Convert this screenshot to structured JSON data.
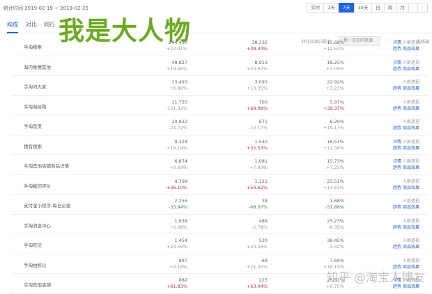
{
  "header": {
    "date_range": "统计时间 2019-02-19 ~ 2019-02-25",
    "periods": [
      "实时",
      "1天",
      "7天",
      "30天",
      "日",
      "周",
      "月"
    ],
    "active_period": "7天",
    "prev": "‹",
    "next": "›"
  },
  "tabs": [
    {
      "label": "构成",
      "active": true
    },
    {
      "label": "对比"
    },
    {
      "label": "同行"
    }
  ],
  "watermark": "我是大人物",
  "attribution": {
    "label": "转化效果归属于：",
    "value": "每一次访问来源",
    "info": "ⓘ",
    "wireless": "无线端"
  },
  "actions": {
    "detail": "详情",
    "crowd": "人群透视",
    "trend": "趋势",
    "goods": "商品效果"
  },
  "rows": [
    {
      "name": "手淘搜索",
      "a": "244,420",
      "ad": "+22.91%",
      "b": "38,332",
      "bd": "+38.44%",
      "bc": "red",
      "c": "15.68%",
      "cd": "+12.63%",
      "detail": true
    },
    {
      "name": "淘内免费其他",
      "a": "48,827",
      "ad": "+19.96%",
      "b": "8,913",
      "bd": "+23.67%",
      "c": "18.25%",
      "cd": "+3.09%",
      "detail": true
    },
    {
      "name": "手淘问大家",
      "a": "13,493",
      "ad": "+6.89%",
      "b": "3,093",
      "bd": "+10.35%",
      "c": "22.92%",
      "cd": "+3.23%"
    },
    {
      "name": "手淘淘抢购",
      "a": "11,735",
      "ad": "+21.32%",
      "b": "700",
      "bd": "+69.08%",
      "bc": "red",
      "c": "5.97%",
      "cd": "+39.37%",
      "cc": "red"
    },
    {
      "name": "手淘首页",
      "a": "10,822",
      "ad": "-24.72%",
      "b": "671",
      "bd": "-10.17%",
      "c": "6.20%",
      "cd": "+19.13%"
    },
    {
      "name": "猜有搜索",
      "a": "9,328",
      "ad": "+18.14%",
      "b": "1,540",
      "bd": "+32.53%",
      "bc": "red",
      "c": "16.51%",
      "cd": "+12.38%",
      "detail": true
    },
    {
      "name": "手淘其他店铺商品详情",
      "a": "6,874",
      "ad": "+0.69%",
      "b": "1,081",
      "bd": "+7.99%",
      "c": "15.73%",
      "cd": "+7.25%",
      "detail": true
    },
    {
      "name": "手淘我的评价",
      "a": "4,769",
      "ad": "+36.10%",
      "ac": "red",
      "b": "1,121",
      "bd": "+54.62%",
      "bc": "red",
      "c": "23.51%",
      "cd": "+13.61%"
    },
    {
      "name": "支付宝小程序-每日必抢",
      "a": "2,256",
      "ad": "-33.94%",
      "ac": "green",
      "b": "38",
      "bd": "-68.07%",
      "bc": "green",
      "c": "1.68%",
      "cd": "-51.66%",
      "cc": "green"
    },
    {
      "name": "手淘消息中心",
      "a": "1,938",
      "ad": "+6.08%",
      "b": "489",
      "bd": "-2.78%",
      "c": "25.23%",
      "cd": "-8.35%"
    },
    {
      "name": "手淘旺信",
      "a": "1,454",
      "ad": "+24.59%",
      "b": "530",
      "bd": "+20.45%",
      "c": "36.45%",
      "cd": "-3.32%"
    },
    {
      "name": "手淘拍照以",
      "a": "897",
      "ad": "+4.18%",
      "b": "69",
      "bd": "+21.05%",
      "c": "7.69%",
      "cd": "+16.19%"
    },
    {
      "name": "手淘其他店铺",
      "a": "882",
      "ad": "+61.83%",
      "ac": "red",
      "b": "225",
      "bd": "+63.04%",
      "bc": "red",
      "c": "25.51%",
      "cd": "+0.75%",
      "detail": true
    }
  ],
  "zhihu_watermark": "知乎 @淘宝人博友"
}
